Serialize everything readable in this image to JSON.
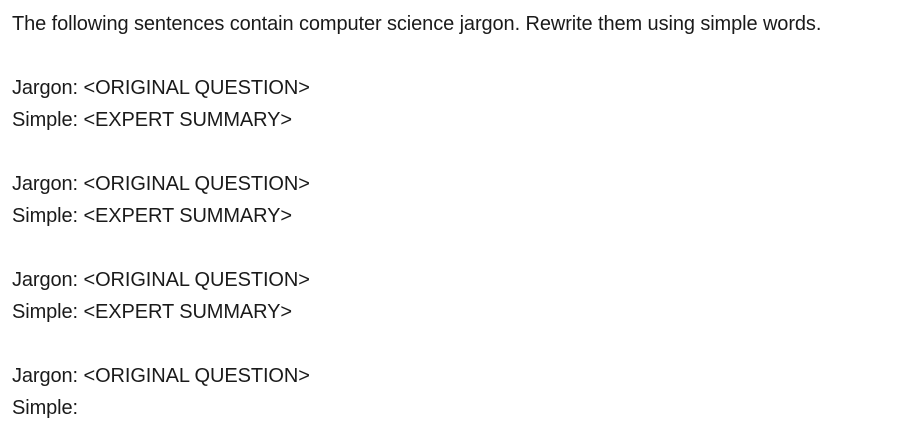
{
  "instruction": "The following sentences contain computer science jargon. Rewrite them using simple words.",
  "examples": [
    {
      "jargon_label": "Jargon:",
      "jargon_value": "<ORIGINAL QUESTION>",
      "simple_label": "Simple:",
      "simple_value": "<EXPERT SUMMARY>"
    },
    {
      "jargon_label": "Jargon:",
      "jargon_value": "<ORIGINAL QUESTION>",
      "simple_label": "Simple:",
      "simple_value": "<EXPERT SUMMARY>"
    },
    {
      "jargon_label": "Jargon:",
      "jargon_value": "<ORIGINAL QUESTION>",
      "simple_label": "Simple:",
      "simple_value": "<EXPERT SUMMARY>"
    },
    {
      "jargon_label": "Jargon:",
      "jargon_value": "<ORIGINAL QUESTION>",
      "simple_label": "Simple:",
      "simple_value": ""
    }
  ]
}
